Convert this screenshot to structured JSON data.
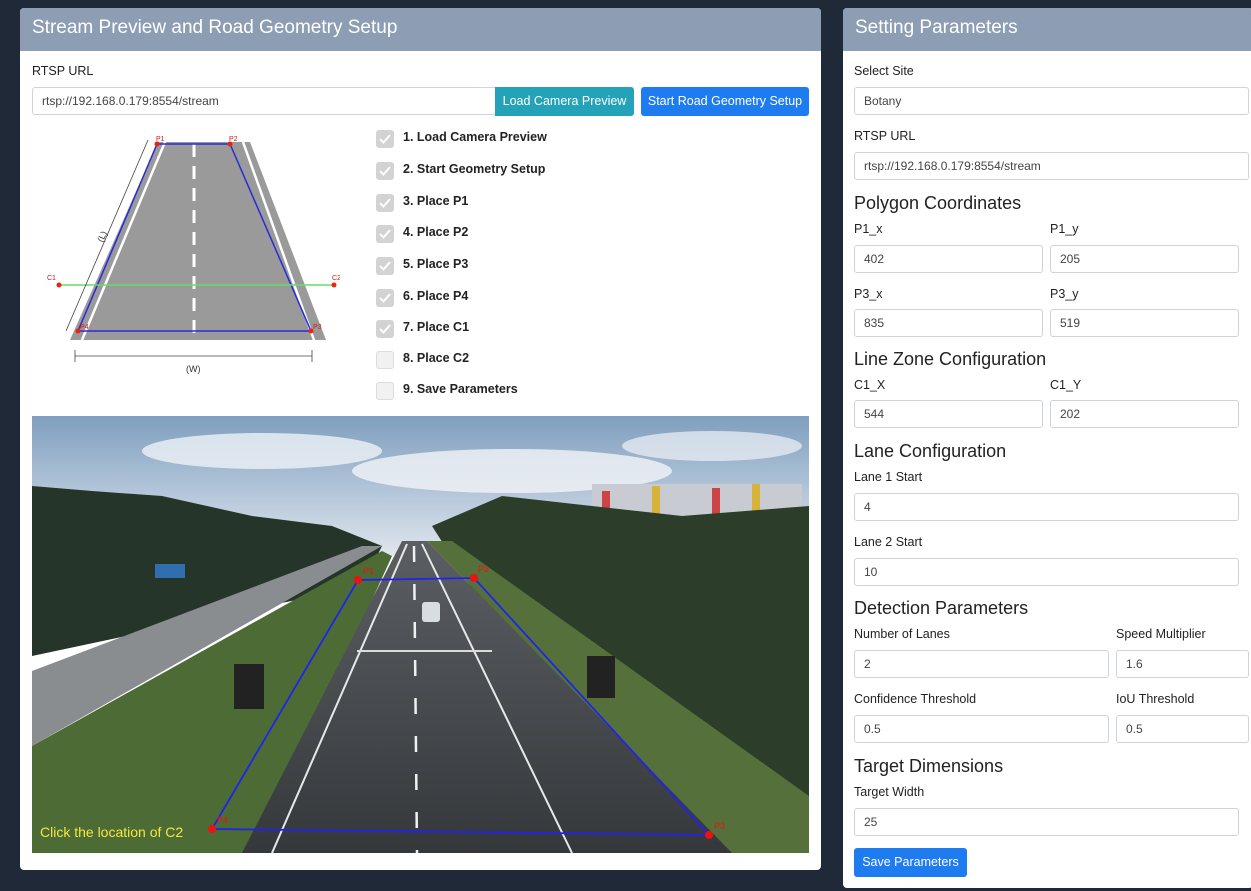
{
  "left_panel": {
    "title": "Stream Preview and Road Geometry Setup",
    "rtsp_label": "RTSP URL",
    "rtsp_value": "rtsp://192.168.0.179:8554/stream",
    "load_preview_button": "Load Camera Preview",
    "start_geometry_button": "Start Road Geometry Setup",
    "diagram": {
      "p1": "P1",
      "p2": "P2",
      "p3": "P3",
      "p4": "P4",
      "c1": "C1",
      "c2": "C2",
      "length_label": "(L)",
      "width_label": "(W)"
    },
    "checklist": [
      {
        "label": "1. Load Camera Preview",
        "checked": true
      },
      {
        "label": "2. Start Geometry Setup",
        "checked": true
      },
      {
        "label": "3. Place P1",
        "checked": true
      },
      {
        "label": "4. Place P2",
        "checked": true
      },
      {
        "label": "5. Place P3",
        "checked": true
      },
      {
        "label": "6. Place P4",
        "checked": true
      },
      {
        "label": "7. Place C1",
        "checked": true
      },
      {
        "label": "8. Place C2",
        "checked": false
      },
      {
        "label": "9. Save Parameters",
        "checked": false
      }
    ],
    "preview": {
      "instruction": "Click the location of C2",
      "marker_p1": "P1",
      "marker_p2": "P2",
      "marker_p3": "P3",
      "marker_p4": "P4",
      "line_color": "#2222ee",
      "marker_color": "#ee1111"
    }
  },
  "right_panel": {
    "title": "Setting Parameters",
    "site_label": "Select Site",
    "site_value": "Botany",
    "rtsp_label": "RTSP URL",
    "rtsp_value": "rtsp://192.168.0.179:8554/stream",
    "polygon_heading": "Polygon Coordinates",
    "p1x_label": "P1_x",
    "p1x_value": "402",
    "p1y_label": "P1_y",
    "p1y_value": "205",
    "p3x_label": "P3_x",
    "p3x_value": "835",
    "p3y_label": "P3_y",
    "p3y_value": "519",
    "line_zone_heading": "Line Zone Configuration",
    "c1x_label": "C1_X",
    "c1x_value": "544",
    "c1y_label": "C1_Y",
    "c1y_value": "202",
    "lane_heading": "Lane Configuration",
    "lane1_label": "Lane 1 Start",
    "lane1_value": "4",
    "lane2_label": "Lane 2 Start",
    "lane2_value": "10",
    "detection_heading": "Detection Parameters",
    "num_lanes_label": "Number of Lanes",
    "num_lanes_value": "2",
    "speed_mult_label": "Speed Multiplier",
    "speed_mult_value": "1.6",
    "conf_label": "Confidence Threshold",
    "conf_value": "0.5",
    "iou_label": "IoU Threshold",
    "iou_value": "0.5",
    "target_heading": "Target Dimensions",
    "target_width_label": "Target Width",
    "target_width_value": "25",
    "save_button": "Save Parameters"
  },
  "colors": {
    "header": "#8d9db3",
    "teal_button": "#23a2b8",
    "blue_button": "#1f7cf0",
    "background": "#1f2937"
  }
}
